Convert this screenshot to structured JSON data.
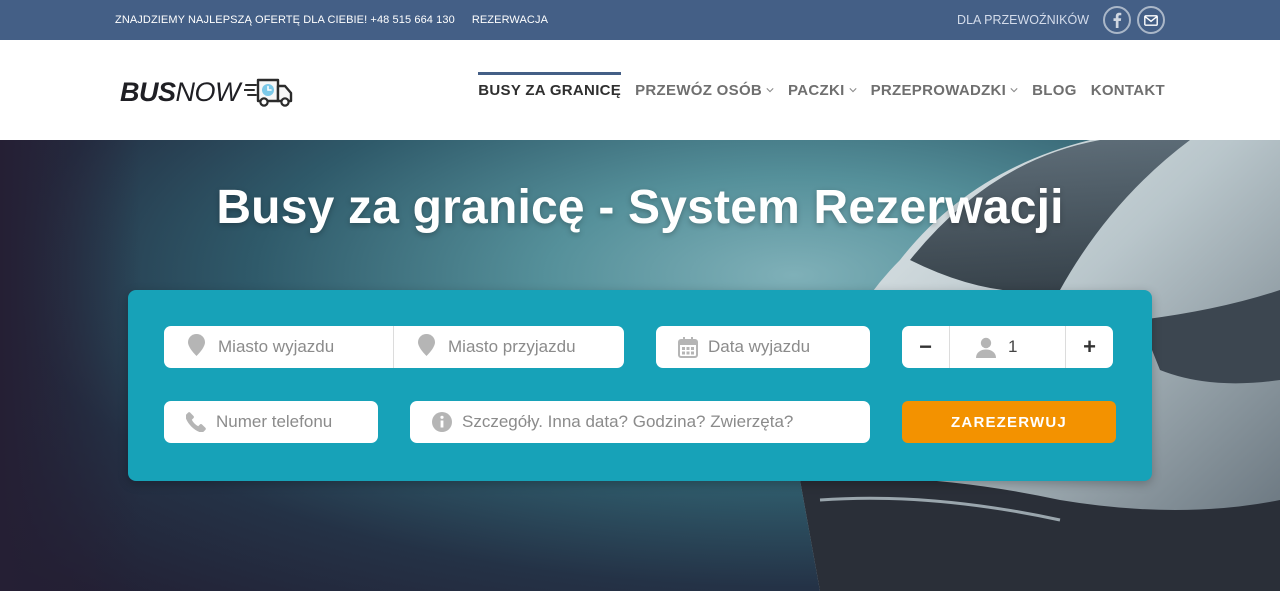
{
  "topbar": {
    "promo": "ZNAJDZIEMY NAJLEPSZĄ OFERTĘ DLA CIEBIE! +48 515 664 130",
    "reservation_link": "REZERWACJA",
    "carriers_link": "DLA PRZEWOŹNIKÓW",
    "social_icons": [
      "facebook-icon",
      "email-icon"
    ]
  },
  "header": {
    "logo_bold": "BUS",
    "logo_light": "NOW",
    "nav": [
      {
        "label": "BUSY ZA GRANICĘ",
        "active": true,
        "dropdown": false
      },
      {
        "label": "PRZEWÓZ OSÓB",
        "active": false,
        "dropdown": true
      },
      {
        "label": "PACZKI",
        "active": false,
        "dropdown": true
      },
      {
        "label": "PRZEPROWADZKI",
        "active": false,
        "dropdown": true
      },
      {
        "label": "BLOG",
        "active": false,
        "dropdown": false
      },
      {
        "label": "KONTAKT",
        "active": false,
        "dropdown": false
      }
    ]
  },
  "hero": {
    "title": "Busy za granicę - System Rezerwacji"
  },
  "booking": {
    "from_placeholder": "Miasto wyjazdu",
    "to_placeholder": "Miasto przyjazdu",
    "date_placeholder": "Data wyjazdu",
    "passengers_value": "1",
    "minus_label": "−",
    "plus_label": "+",
    "phone_placeholder": "Numer telefonu",
    "details_placeholder": "Szczegóły. Inna data? Godzina? Zwierzęta?",
    "submit_label": "ZAREZERWUJ"
  },
  "colors": {
    "topbar_bg": "#445f86",
    "panel_bg": "#17a2b8",
    "submit_bg": "#f39200",
    "nav_active_underline": "#445f86"
  }
}
